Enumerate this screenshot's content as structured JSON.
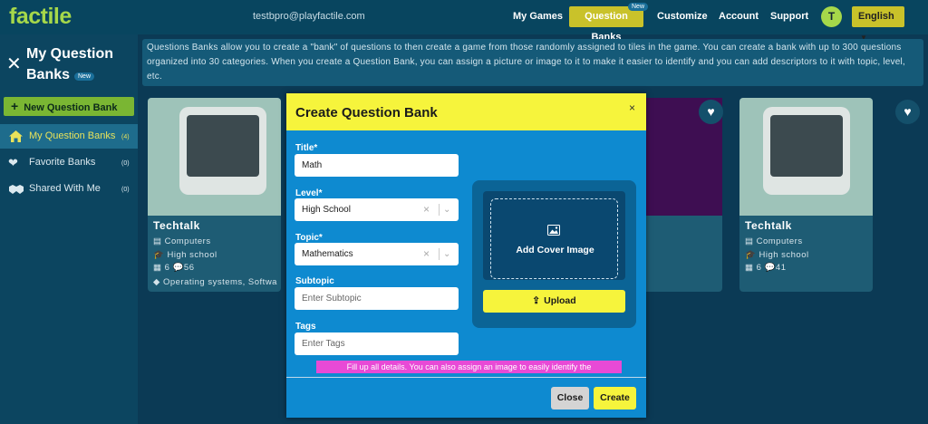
{
  "header": {
    "logo": "factile",
    "email": "testbpro@playfactile.com",
    "nav": [
      "My Games",
      "Question Banks",
      "Customize",
      "Account",
      "Support"
    ],
    "nav_badge": "New",
    "avatar_initial": "T",
    "language": "English"
  },
  "sidebar": {
    "title": "My Question Banks",
    "title_badge": "New",
    "new_button": "New Question Bank",
    "items": [
      {
        "label": "My Question Banks",
        "count": "(4)",
        "icon": "home-icon"
      },
      {
        "label": "Favorite Banks",
        "count": "(0)",
        "icon": "heart-icon"
      },
      {
        "label": "Shared With Me",
        "count": "(0)",
        "icon": "handshake-icon"
      }
    ]
  },
  "info_text": "Questions Banks allow you to create a \"bank\" of questions to then create a game from those randomly assigned to tiles in the game. You can create a bank with up to 300 questions organized into 30 categories. When you create a Question Bank, you can assign a picture or image to it to make it easier to identify and you can add descriptors to it with topic, level, etc.",
  "cards": [
    {
      "title": "Techtalk",
      "topic": "Computers",
      "level": "High school",
      "categories": "6",
      "questions": "56",
      "tags": "Operating systems, Softwa"
    },
    {
      "title": "Techtalk",
      "topic": "Computers",
      "level": "High school",
      "categories": "6",
      "questions": "41"
    }
  ],
  "modal": {
    "title": "Create Question Bank",
    "close_x": "×",
    "title_label": "Title*",
    "title_value": "Math",
    "level_label": "Level*",
    "level_value": "High School",
    "topic_label": "Topic*",
    "topic_value": "Mathematics",
    "subtopic_label": "Subtopic",
    "subtopic_placeholder": "Enter Subtopic",
    "tags_label": "Tags",
    "tags_placeholder": "Enter Tags",
    "cover_label": "Add Cover Image",
    "upload_label": "Upload",
    "hint": "Fill up all details. You can also assign an image  to easily identify the",
    "close_button": "Close",
    "create_button": "Create"
  }
}
